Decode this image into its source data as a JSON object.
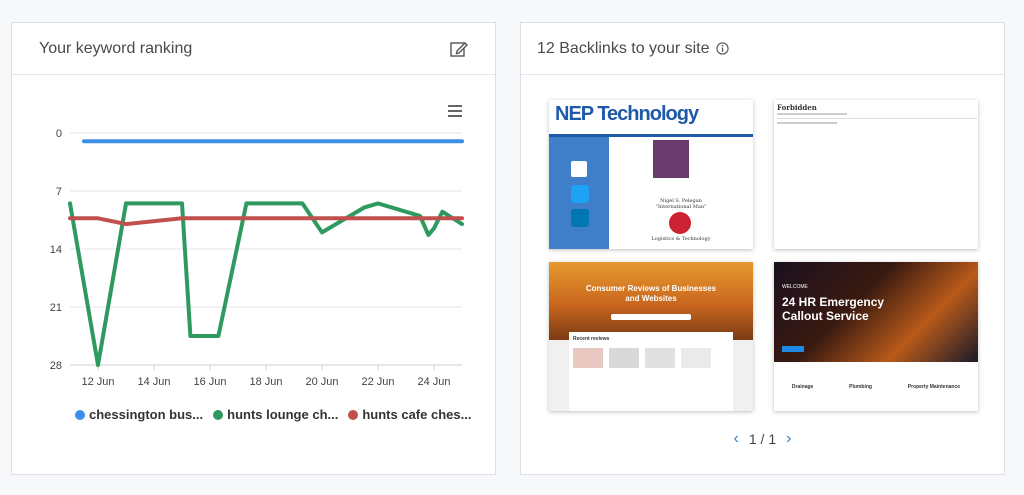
{
  "keyword_card": {
    "title": "Your keyword ranking",
    "edit_icon": "pencil-square-icon",
    "menu_icon": "hamburger-menu-icon"
  },
  "backlinks_card": {
    "title": "12 Backlinks to your site",
    "info_icon": "info-circle-icon",
    "thumbnails": [
      {
        "logo_text": "NEP Technology",
        "caption1": "Nigel S. Pelegan",
        "caption2": "\"International Man\"",
        "caption3": "Logistics & Technology"
      },
      {
        "heading": "Forbidden"
      },
      {
        "headline": "Consumer Reviews of Businesses and Websites",
        "section": "Recent reviews"
      },
      {
        "headline": "24 HR Emergency Callout Service",
        "welcome": "WELCOME",
        "services": [
          "Drainage",
          "Plumbing",
          "Property Maintenance"
        ]
      }
    ],
    "pager": {
      "current": "1 / 1",
      "prev_icon": "chevron-left-icon",
      "next_icon": "chevron-right-icon"
    }
  },
  "chart_data": {
    "type": "line",
    "y_reversed": true,
    "ylim": [
      0,
      28
    ],
    "yticks": [
      0,
      7,
      14,
      21,
      28
    ],
    "xlim": [
      "2024-06-11",
      "2024-06-25"
    ],
    "xticks": [
      "12 Jun",
      "14 Jun",
      "16 Jun",
      "18 Jun",
      "20 Jun",
      "22 Jun",
      "24 Jun"
    ],
    "grid": true,
    "legend_position": "bottom",
    "series": [
      {
        "name": "chessington bus...",
        "color": "#3b8de6",
        "points": [
          [
            "2024-06-11.5",
            1
          ],
          [
            "2024-06-25",
            1
          ]
        ]
      },
      {
        "name": "hunts lounge ch...",
        "color": "#2e9a5f",
        "points": [
          [
            "2024-06-11",
            8.5
          ],
          [
            "2024-06-12",
            28
          ],
          [
            "2024-06-13",
            8.5
          ],
          [
            "2024-06-15",
            8.5
          ],
          [
            "2024-06-15.3",
            24.5
          ],
          [
            "2024-06-16.3",
            24.5
          ],
          [
            "2024-06-17.3",
            8.5
          ],
          [
            "2024-06-19.3",
            8.5
          ],
          [
            "2024-06-20",
            12
          ],
          [
            "2024-06-21.5",
            9
          ],
          [
            "2024-06-22",
            8.5
          ],
          [
            "2024-06-23.5",
            10
          ],
          [
            "2024-06-23.8",
            12.3
          ],
          [
            "2024-06-24",
            11.5
          ],
          [
            "2024-06-24.3",
            9.5
          ],
          [
            "2024-06-25",
            11
          ]
        ]
      },
      {
        "name": "hunts cafe ches...",
        "color": "#c0504d",
        "points": [
          [
            "2024-06-11",
            10.3
          ],
          [
            "2024-06-12",
            10.3
          ],
          [
            "2024-06-13",
            11
          ],
          [
            "2024-06-15",
            10.3
          ],
          [
            "2024-06-19",
            10.3
          ],
          [
            "2024-06-20",
            10.3
          ],
          [
            "2024-06-22",
            10.3
          ],
          [
            "2024-06-23.5",
            10.3
          ],
          [
            "2024-06-24",
            10.3
          ],
          [
            "2024-06-25",
            10.3
          ]
        ]
      }
    ]
  }
}
